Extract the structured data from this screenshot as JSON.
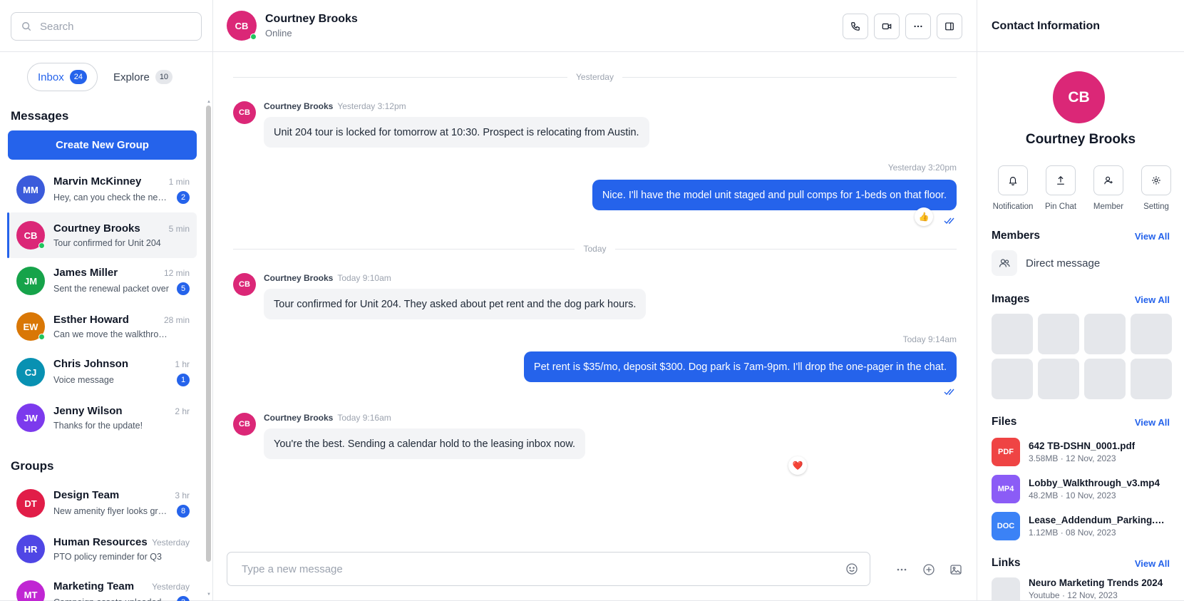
{
  "search": {
    "placeholder": "Search"
  },
  "tabs": [
    {
      "label": "Inbox",
      "count": "24"
    },
    {
      "label": "Explore",
      "count": "10"
    }
  ],
  "sidebar": {
    "messages_title": "Messages",
    "create_group_label": "Create New Group",
    "groups_title": "Groups",
    "contacts": [
      {
        "initials": "MM",
        "name": "Marvin McKinney",
        "time": "1 min",
        "preview": "Hey, can you check the new lease draft?",
        "badge": "2",
        "color": "#3b5bdb",
        "online": false
      },
      {
        "initials": "CB",
        "name": "Courtney Brooks",
        "time": "5 min",
        "preview": "Tour confirmed for Unit 204",
        "badge": "",
        "color": "#db2777",
        "online": true
      },
      {
        "initials": "JM",
        "name": "James Miller",
        "time": "12 min",
        "preview": "Sent the renewal packet over",
        "badge": "5",
        "color": "#16a34a",
        "online": false
      },
      {
        "initials": "EW",
        "name": "Esther Howard",
        "time": "28 min",
        "preview": "Can we move the walkthrough?",
        "badge": "",
        "color": "#d97706",
        "online": true
      },
      {
        "initials": "CJ",
        "name": "Chris Johnson",
        "time": "1 hr",
        "preview": "Voice message",
        "badge": "1",
        "color": "#0891b2",
        "online": false
      },
      {
        "initials": "JW",
        "name": "Jenny Wilson",
        "time": "2 hr",
        "preview": "Thanks for the update!",
        "badge": "",
        "color": "#7c3aed",
        "online": false
      }
    ],
    "groups": [
      {
        "initials": "DT",
        "name": "Design Team",
        "time": "3 hr",
        "preview": "New amenity flyer looks great",
        "badge": "8",
        "color": "#e11d48"
      },
      {
        "initials": "HR",
        "name": "Human Resources",
        "time": "Yesterday",
        "preview": "PTO policy reminder for Q3",
        "badge": "",
        "color": "#4f46e5"
      },
      {
        "initials": "MT",
        "name": "Marketing Team",
        "time": "Yesterday",
        "preview": "Campaign assets uploaded",
        "badge": "3",
        "color": "#c026d3"
      }
    ]
  },
  "chat": {
    "initials": "CB",
    "name": "Courtney Brooks",
    "status": "Online",
    "divider_yesterday": "Yesterday",
    "divider_today": "Today",
    "messages": [
      {
        "who": "Courtney Brooks",
        "when": "Yesterday 3:12pm",
        "text": "Unit 204 tour is locked for tomorrow at 10:30. Prospect is relocating from Austin."
      },
      {
        "when": "Yesterday 3:20pm",
        "text": "Nice. I'll have the model unit staged and pull comps for 1-beds on that floor.",
        "reaction": "👍"
      },
      {
        "who": "Courtney Brooks",
        "when": "Today 9:10am",
        "text": "Tour confirmed for Unit 204. They asked about pet rent and the dog park hours."
      },
      {
        "when": "Today 9:14am",
        "text": "Pet rent is $35/mo, deposit $300. Dog park is 7am-9pm. I'll drop the one-pager in the chat."
      },
      {
        "who": "Courtney Brooks",
        "when": "Today 9:16am",
        "text": "You're the best. Sending a calendar hold to the leasing inbox now.",
        "reaction": "❤️"
      }
    ],
    "composer_placeholder": "Type a new message"
  },
  "contact_info": {
    "title": "Contact Information",
    "initials": "CB",
    "name": "Courtney Brooks",
    "actions": [
      "Notification",
      "Pin Chat",
      "Member",
      "Setting"
    ],
    "members_title": "Members",
    "images_title": "Images",
    "files_title": "Files",
    "links_title": "Links",
    "view_all": "View All",
    "member_item": "Direct message",
    "files": [
      {
        "type": "PDF",
        "name": "642 TB-DSHN_0001.pdf",
        "meta": "3.58MB · 12 Nov, 2023",
        "color": "#ef4444"
      },
      {
        "type": "MP4",
        "name": "Lobby_Walkthrough_v3.mp4",
        "meta": "48.2MB · 10 Nov, 2023",
        "color": "#8b5cf6"
      },
      {
        "type": "DOC",
        "name": "Lease_Addendum_Parking.docx",
        "meta": "1.12MB · 08 Nov, 2023",
        "color": "#3b82f6"
      }
    ],
    "link": {
      "title": "Neuro Marketing Trends 2024",
      "meta": "Youtube · 12 Nov, 2023"
    }
  }
}
